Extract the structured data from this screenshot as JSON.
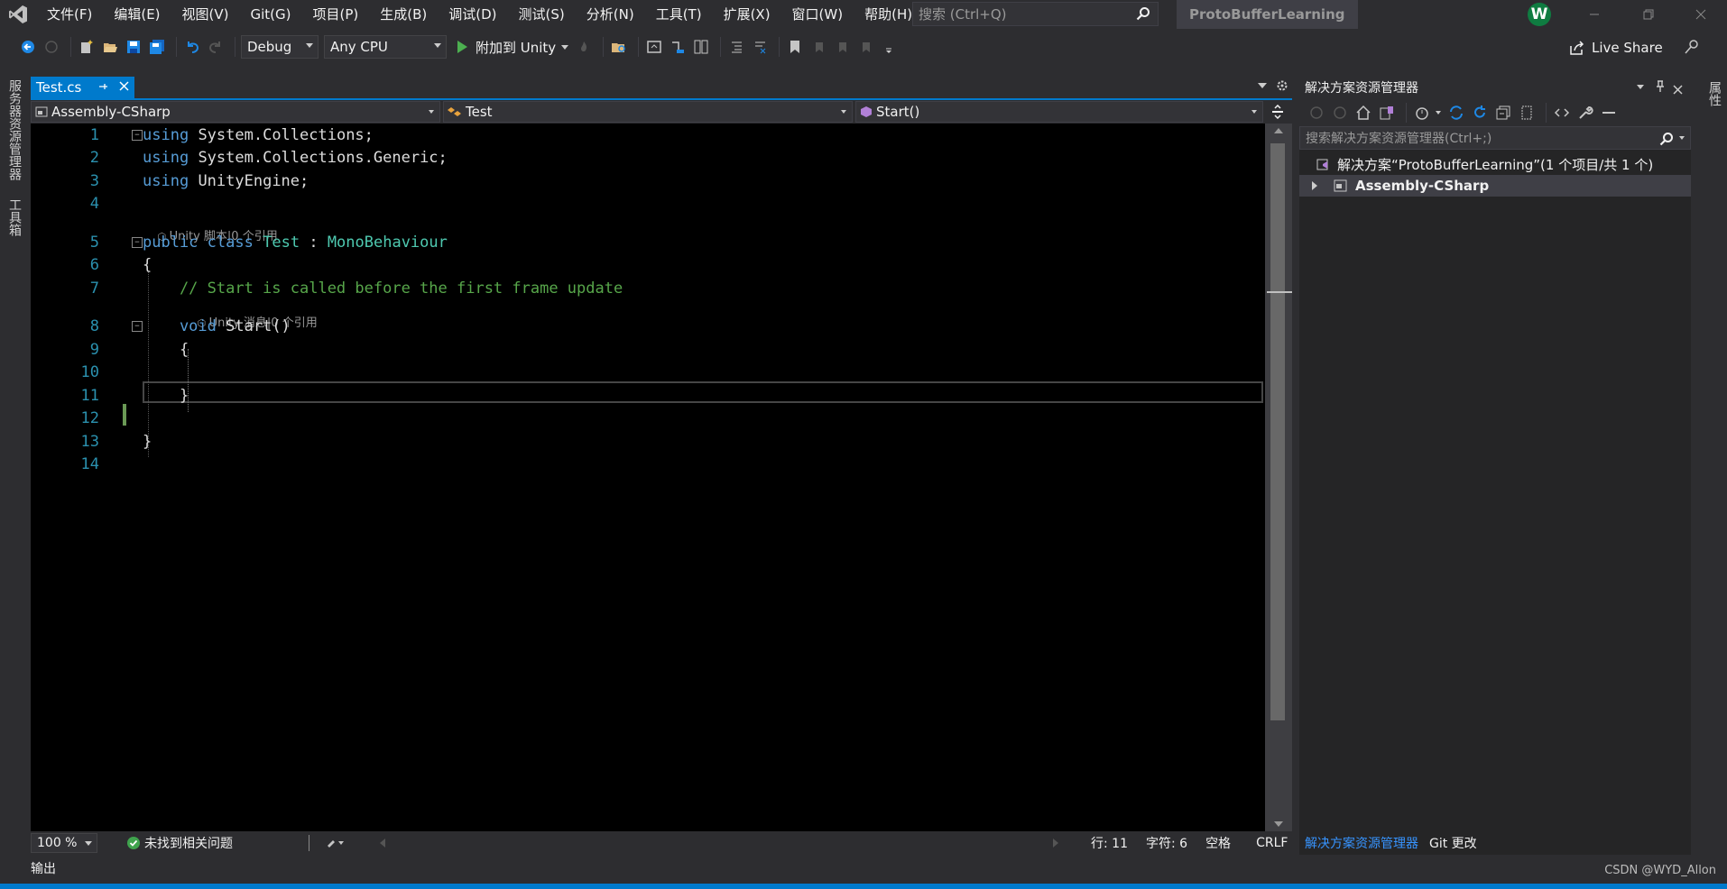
{
  "menu": [
    "文件(F)",
    "编辑(E)",
    "视图(V)",
    "Git(G)",
    "项目(P)",
    "生成(B)",
    "调试(D)",
    "测试(S)",
    "分析(N)",
    "工具(T)",
    "扩展(X)",
    "窗口(W)",
    "帮助(H)"
  ],
  "search": {
    "placeholder": "搜索 (Ctrl+Q)"
  },
  "app_title": "ProtoBufferLearning",
  "user_initial": "W",
  "toolbar": {
    "config": "Debug",
    "platform": "Any CPU",
    "attach_label": "附加到 Unity",
    "live_share": "Live Share"
  },
  "left_tabs": [
    "服务器资源管理器",
    "工具箱"
  ],
  "right_tabs": [
    "属性"
  ],
  "doc_tab": {
    "name": "Test.cs"
  },
  "nav": {
    "project": "Assembly-CSharp",
    "class": "Test",
    "member": "Start()"
  },
  "editor": {
    "lines": [
      {
        "n": "1",
        "seg": [
          [
            "kw",
            "using"
          ],
          [
            "",
            "System.Collections;"
          ]
        ]
      },
      {
        "n": "2",
        "seg": [
          [
            "kw",
            "using"
          ],
          [
            "",
            "System.Collections.Generic;"
          ]
        ]
      },
      {
        "n": "3",
        "seg": [
          [
            "kw",
            "using"
          ],
          [
            "",
            "UnityEngine;"
          ]
        ]
      },
      {
        "n": "4",
        "seg": []
      },
      {
        "n": "5",
        "seg": [
          [
            "kw",
            "public"
          ],
          [
            "kw",
            "class"
          ],
          [
            "ty",
            "Test"
          ],
          [
            "",
            ":"
          ],
          [
            "ty",
            "MonoBehaviour"
          ]
        ]
      },
      {
        "n": "6",
        "seg": [
          [
            "",
            "{"
          ]
        ]
      },
      {
        "n": "7",
        "seg": [
          [
            "cm",
            "    // Start is called before the first frame update"
          ]
        ]
      },
      {
        "n": "8",
        "seg": [
          [
            "kw",
            "    void"
          ],
          [
            "",
            "Start()"
          ]
        ]
      },
      {
        "n": "9",
        "seg": [
          [
            "",
            "    {"
          ]
        ]
      },
      {
        "n": "10",
        "seg": []
      },
      {
        "n": "11",
        "seg": [
          [
            "",
            "    }"
          ]
        ]
      },
      {
        "n": "12",
        "seg": []
      },
      {
        "n": "13",
        "seg": [
          [
            "",
            "}"
          ]
        ]
      },
      {
        "n": "14",
        "seg": []
      }
    ],
    "codelens_class": "Unity 脚本|0 个引用",
    "codelens_method": "Unity 消息|0 个引用"
  },
  "editor_status": {
    "zoom": "100 %",
    "issues": "未找到相关问题",
    "row": "行: 11",
    "col": "字符: 6",
    "ws": "空格",
    "eol": "CRLF"
  },
  "solution_explorer": {
    "title": "解决方案资源管理器",
    "search_placeholder": "搜索解决方案资源管理器(Ctrl+;)",
    "solution_item": "解决方案“ProtoBufferLearning”(1 个项目/共 1 个)",
    "project_item": "Assembly-CSharp",
    "tabs": [
      "解决方案资源管理器",
      "Git 更改"
    ]
  },
  "output_label": "输出",
  "watermark": "CSDN @WYD_Allon",
  "colors": {
    "accent": "#007acc",
    "keyword": "#569cd6",
    "type": "#4ec9b0",
    "comment": "#57a64a",
    "line_number": "#2b91af"
  }
}
